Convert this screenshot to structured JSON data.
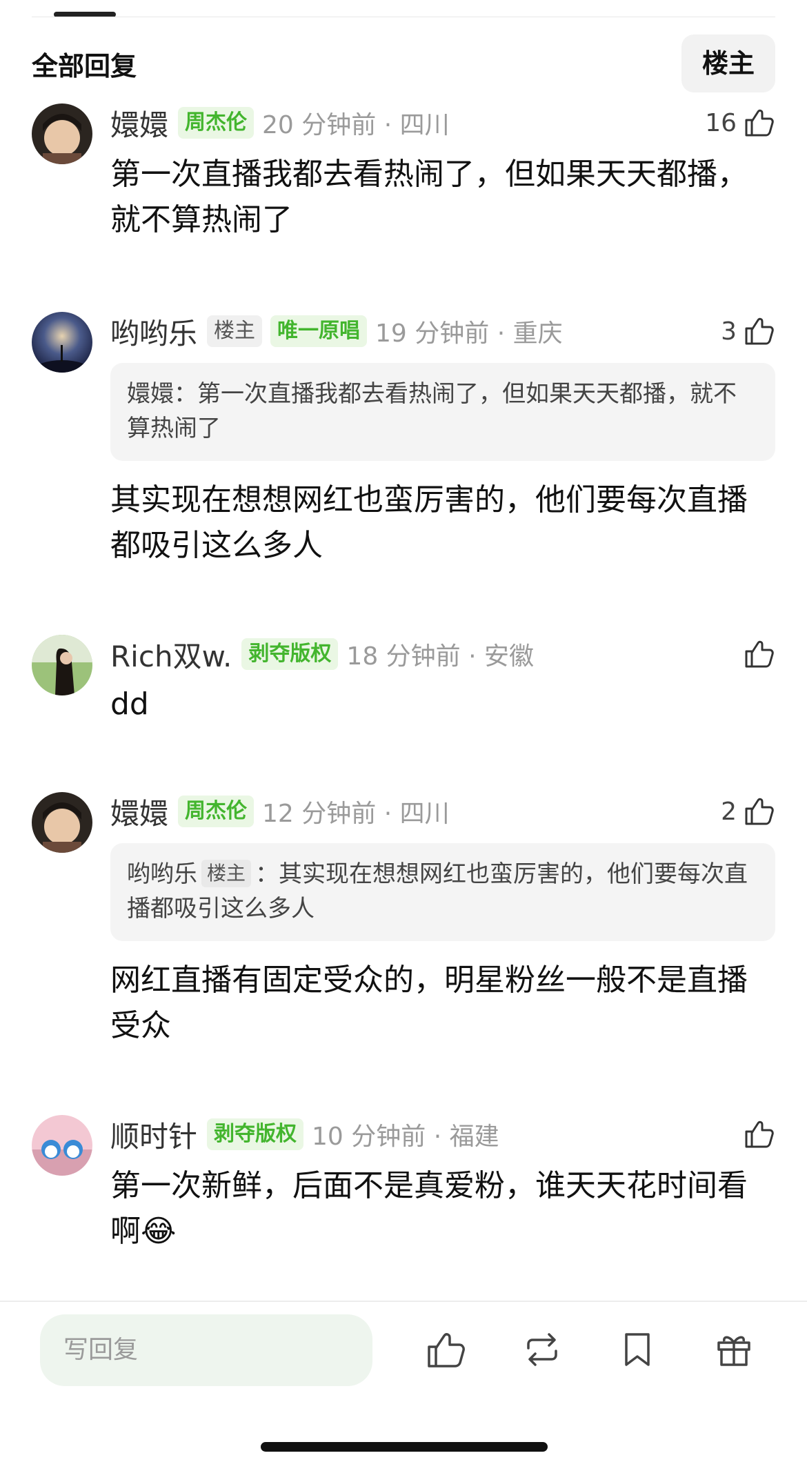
{
  "header": {
    "title": "全部回复",
    "op_filter": "楼主"
  },
  "comments": [
    {
      "username": "嬛嬛",
      "badges": [
        "周杰伦"
      ],
      "time": "20 分钟前 · 四川",
      "likes": "16",
      "body": "第一次直播我都去看热闹了，但如果天天都播，就不算热闹了"
    },
    {
      "username": "哟哟乐",
      "badges": [
        "楼主",
        "唯一原唱"
      ],
      "time": "19 分钟前 · 重庆",
      "likes": "3",
      "quote": {
        "name": "嬛嬛",
        "badge": "",
        "text": "：第一次直播我都去看热闹了，但如果天天都播，就不算热闹了"
      },
      "body": "其实现在想想网红也蛮厉害的，他们要每次直播都吸引这么多人"
    },
    {
      "username": "Rich双w.",
      "badges": [
        "剥夺版权"
      ],
      "time": "18 分钟前 · 安徽",
      "likes": "",
      "body": "dd"
    },
    {
      "username": "嬛嬛",
      "badges": [
        "周杰伦"
      ],
      "time": "12 分钟前 · 四川",
      "likes": "2",
      "quote": {
        "name": "哟哟乐",
        "badge": "楼主",
        "text": "：其实现在想想网红也蛮厉害的，他们要每次直播都吸引这么多人"
      },
      "body": "网红直播有固定受众的，明星粉丝一般不是直播受众"
    },
    {
      "username": "顺时针",
      "badges": [
        "剥夺版权"
      ],
      "time": "10 分钟前 · 福建",
      "likes": "",
      "body": "第一次新鲜，后面不是真爱粉，谁天天花时间看啊😂"
    }
  ],
  "bottom_bar": {
    "reply_placeholder": "写回复",
    "icons": [
      "thumbs-up-icon",
      "repost-icon",
      "bookmark-icon",
      "gift-icon"
    ]
  },
  "colors": {
    "badge_green": "#43b52e",
    "badge_green_bg": "#eaf7e4",
    "reply_bg": "#eef5ee"
  }
}
